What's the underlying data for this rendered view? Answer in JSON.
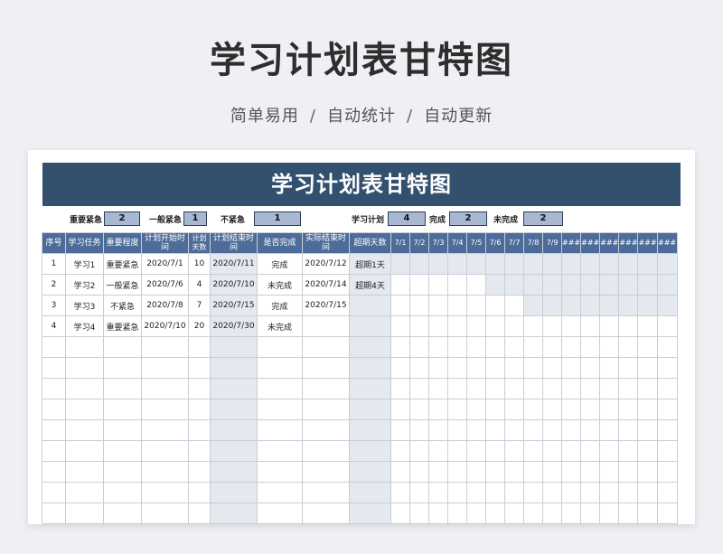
{
  "hero": {
    "title": "学习计划表甘特图",
    "tags": [
      "简单易用",
      "自动统计",
      "自动更新"
    ],
    "separator": "/"
  },
  "sheet": {
    "banner": "学习计划表甘特图",
    "stats": [
      {
        "label": "重要紧急",
        "value": "2"
      },
      {
        "label": "一般紧急",
        "value": "1"
      },
      {
        "label": "不紧急",
        "value": "1"
      },
      {
        "label": "学习计划",
        "value": "4"
      },
      {
        "label": "完成",
        "value": "2"
      },
      {
        "label": "未完成",
        "value": "2"
      }
    ],
    "columns": [
      "序号",
      "学习任务",
      "重要程度",
      "计划开始时间",
      "计划天数",
      "计划结束时间",
      "是否完成",
      "实际结束时间",
      "超期天数"
    ],
    "dates": [
      "7/1",
      "7/2",
      "7/3",
      "7/4",
      "7/5",
      "7/6",
      "7/7",
      "7/8",
      "7/9",
      "###",
      "###",
      "###",
      "###",
      "###",
      "###"
    ],
    "rows": [
      {
        "no": "1",
        "task": "学习1",
        "level": "重要紧急",
        "start": "2020/7/1",
        "days": "10",
        "end": "2020/7/11",
        "done": "完成",
        "actual": "2020/7/12",
        "overdue": "超期1天",
        "bar": [
          0,
          14
        ]
      },
      {
        "no": "2",
        "task": "学习2",
        "level": "一般紧急",
        "start": "2020/7/6",
        "days": "4",
        "end": "2020/7/10",
        "done": "未完成",
        "actual": "2020/7/14",
        "overdue": "超期4天",
        "bar": [
          5,
          14
        ]
      },
      {
        "no": "3",
        "task": "学习3",
        "level": "不紧急",
        "start": "2020/7/8",
        "days": "7",
        "end": "2020/7/15",
        "done": "完成",
        "actual": "2020/7/15",
        "overdue": "",
        "bar": [
          7,
          14
        ]
      },
      {
        "no": "4",
        "task": "学习4",
        "level": "重要紧急",
        "start": "2020/7/10",
        "days": "20",
        "end": "2020/7/30",
        "done": "未完成",
        "actual": "",
        "overdue": "",
        "bar": null
      }
    ],
    "empty_rows": 9
  }
}
